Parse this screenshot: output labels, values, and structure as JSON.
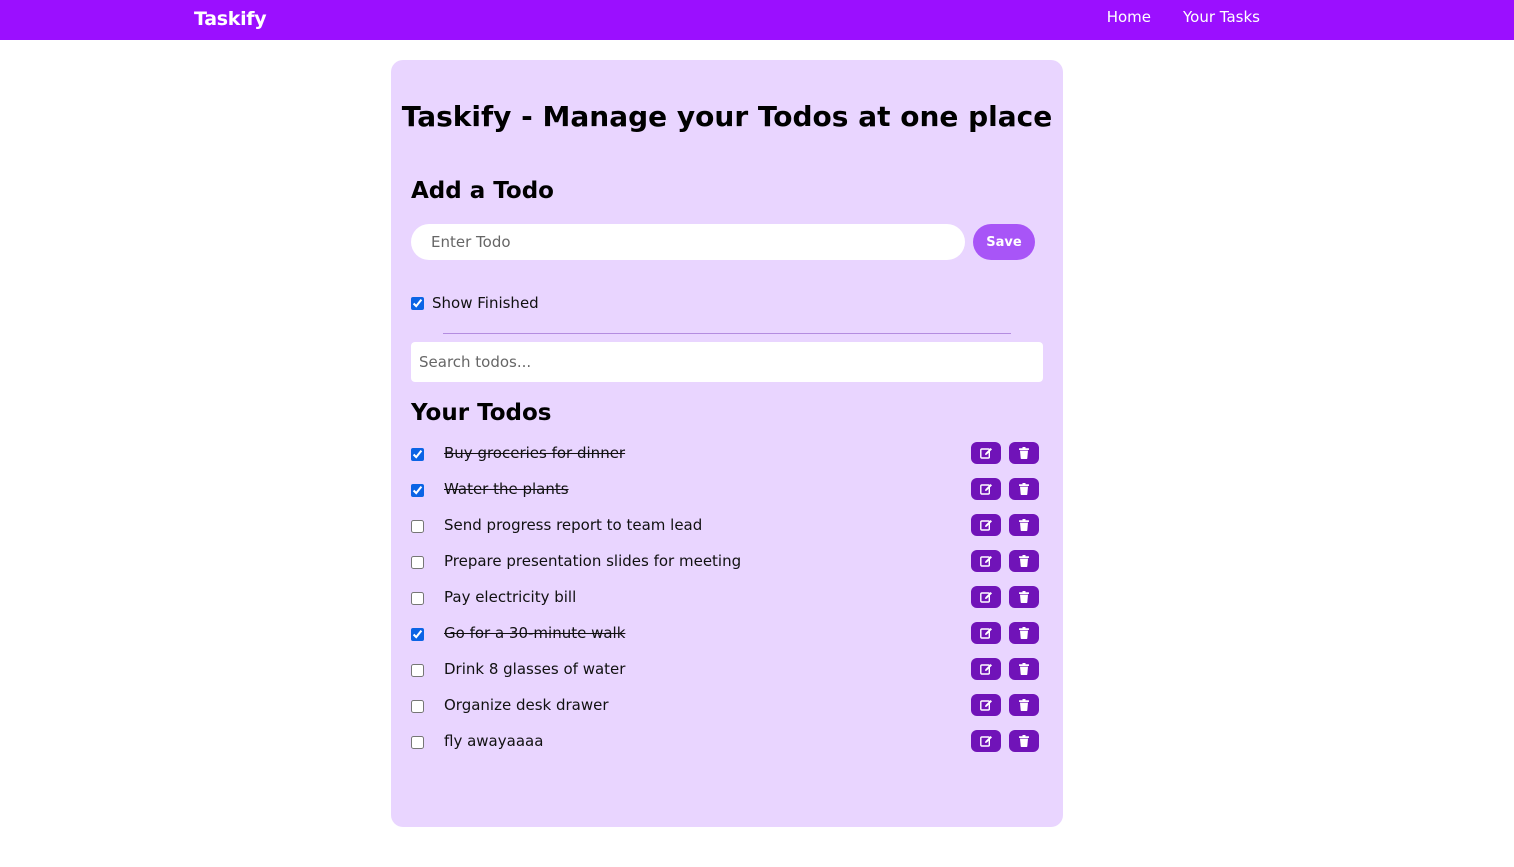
{
  "nav": {
    "brand": "Taskify",
    "links": [
      "Home",
      "Your Tasks"
    ]
  },
  "main": {
    "title": "Taskify - Manage your Todos at one place",
    "add_section_title": "Add a Todo",
    "todo_input_placeholder": "Enter Todo",
    "save_label": "Save",
    "show_finished_label": "Show Finished",
    "show_finished_checked": true,
    "search_placeholder": "Search todos...",
    "list_title": "Your Todos"
  },
  "todos": [
    {
      "text": "Buy groceries for dinner",
      "done": true
    },
    {
      "text": "Water the plants",
      "done": true
    },
    {
      "text": "Send progress report to team lead",
      "done": false
    },
    {
      "text": "Prepare presentation slides for meeting",
      "done": false
    },
    {
      "text": "Pay electricity bill",
      "done": false
    },
    {
      "text": "Go for a 30-minute walk",
      "done": true
    },
    {
      "text": "Drink 8 glasses of water",
      "done": false
    },
    {
      "text": "Organize desk drawer",
      "done": false
    },
    {
      "text": "fly awayaaaa",
      "done": false
    }
  ],
  "icons": {
    "edit": "edit-icon",
    "delete": "trash-icon"
  },
  "colors": {
    "navbar": "#9b0fff",
    "card": "#e9d5ff",
    "save_button": "#a855f7",
    "action_button": "#7013b8",
    "checkbox": "#0b64e5"
  }
}
